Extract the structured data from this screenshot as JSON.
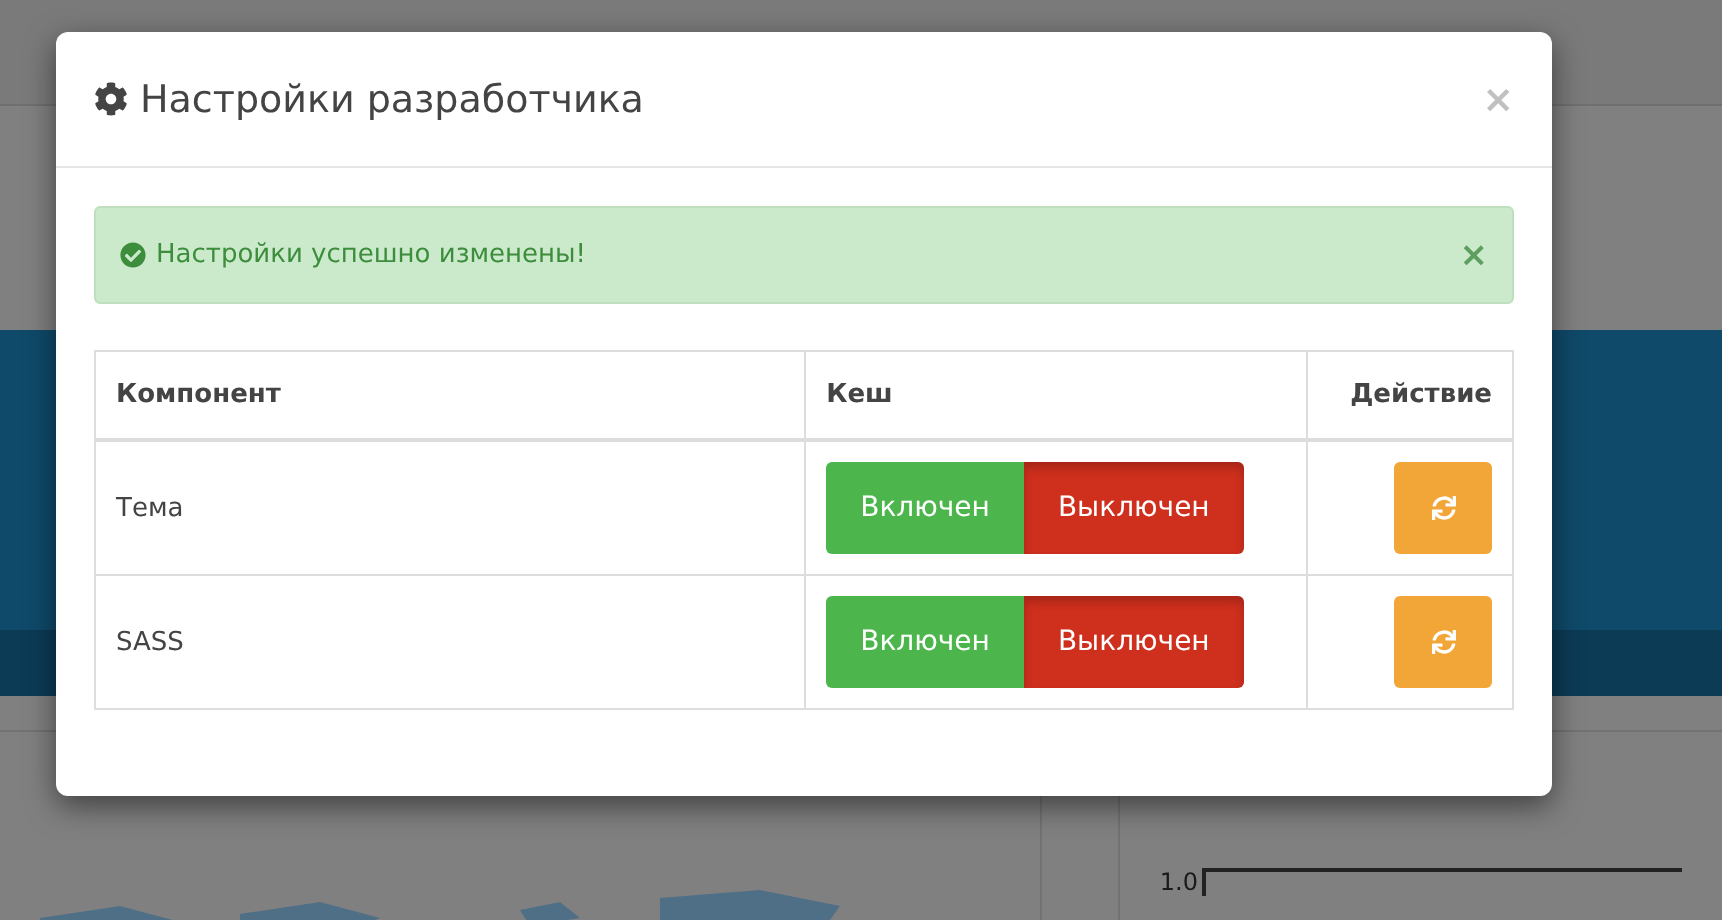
{
  "background": {
    "axis_label": "1.0"
  },
  "modal": {
    "title": "Настройки разработчика",
    "close": "×",
    "alert": {
      "text": "Настройки успешно изменены!",
      "close": "×"
    },
    "table": {
      "columns": [
        "Компонент",
        "Кеш",
        "Действие"
      ],
      "rows": [
        {
          "component": "Тема",
          "options": [
            {
              "label": "Включен",
              "kind": "on",
              "selected": false
            },
            {
              "label": "Выключен",
              "kind": "off",
              "selected": true
            }
          ]
        },
        {
          "component": "SASS",
          "options": [
            {
              "label": "Включен",
              "kind": "on",
              "selected": false
            },
            {
              "label": "Выключен",
              "kind": "off",
              "selected": true
            }
          ]
        }
      ]
    }
  }
}
